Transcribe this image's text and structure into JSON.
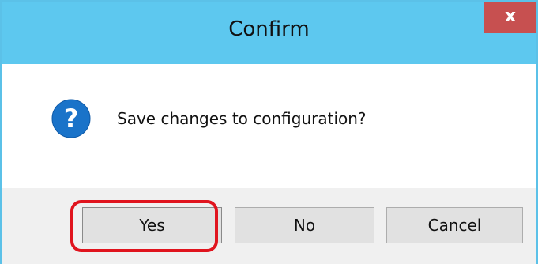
{
  "window": {
    "title": "Confirm",
    "close_glyph": "x",
    "colors": {
      "titlebar": "#5dc8ef",
      "close_button": "#c75050",
      "footer": "#f0f0f0",
      "highlight": "#e0141e"
    }
  },
  "message": {
    "icon": "question-icon",
    "text": "Save changes to configuration?"
  },
  "buttons": {
    "yes": "Yes",
    "no": "No",
    "cancel": "Cancel"
  }
}
